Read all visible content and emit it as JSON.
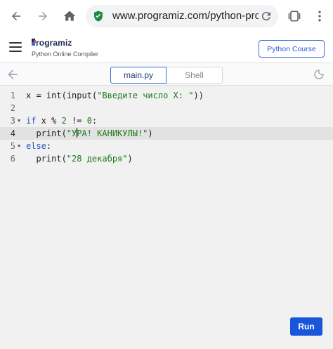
{
  "browser": {
    "url": "www.programiz.com/python-prog",
    "icons": [
      "back-icon",
      "forward-icon",
      "home-icon",
      "shield-check-icon",
      "reload-icon",
      "tab-switcher-icon",
      "more-vert-icon"
    ]
  },
  "header": {
    "logo_text": "rogramiz",
    "subtitle": "Python Online Compiler",
    "course_button": "Python Course"
  },
  "tabs": [
    {
      "label": "main.py",
      "active": true
    },
    {
      "label": "Shell",
      "active": false
    }
  ],
  "editor": {
    "active_line": 4,
    "lines": [
      {
        "num": "1",
        "text": "x = int(input(\"Введите число X: \"))"
      },
      {
        "num": "2",
        "text": ""
      },
      {
        "num": "3",
        "text": "if x % 2 != 0:"
      },
      {
        "num": "4",
        "text": "  print(\"УРА! КАНИКУЛЫ!\")"
      },
      {
        "num": "5",
        "text": "else:"
      },
      {
        "num": "6",
        "text": "  print(\"28 декабря\")"
      }
    ]
  },
  "run_button": "Run",
  "colors": {
    "accent": "#1a56db",
    "keyword": "#2f54c7",
    "string": "#1d7a1d",
    "brand_logo": "#1b2a4e"
  }
}
